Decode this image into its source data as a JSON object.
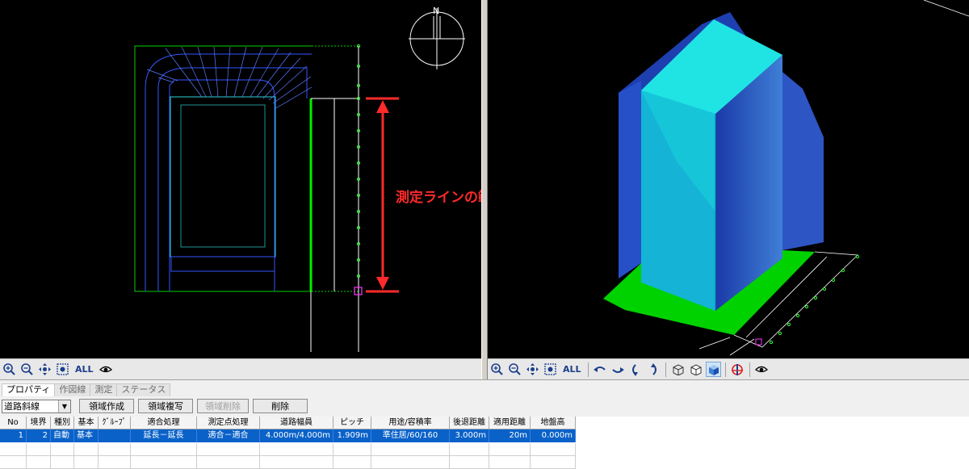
{
  "annotation": {
    "text": "測定ラインの範囲",
    "color": "#ff2a2a"
  },
  "compass": {
    "label": "N"
  },
  "toolbar_left": {
    "buttons": [
      "zoom-in-icon",
      "zoom-out-icon",
      "pan-icon",
      "fit-view-icon",
      "ALL",
      "view-eye-icon"
    ],
    "all_label": "ALL"
  },
  "toolbar_right": {
    "buttons": [
      "zoom-in-icon",
      "zoom-out-icon",
      "pan-icon",
      "fit-view-icon",
      "ALL",
      "rotate-left-icon",
      "rotate-right-icon",
      "rotate-down-icon",
      "rotate-up-icon",
      "wireframe-icon",
      "hidden-line-icon",
      "shaded-icon",
      "axis-icon",
      "view-eye-icon"
    ],
    "all_label": "ALL"
  },
  "panel": {
    "tabs": [
      "プロパティ",
      "作図線",
      "測定",
      "ステータス"
    ],
    "active_tab": 0,
    "select_value": "道路斜線",
    "buttons": {
      "create": "領域作成",
      "copy": "領域複写",
      "delete_region": "領域削除",
      "delete": "削除"
    }
  },
  "table": {
    "headers": [
      "No",
      "境界",
      "種別",
      "基本",
      "ｸﾞﾙｰﾌﾟ",
      "適合処理",
      "測定点処理",
      "道路幅員",
      "ピッチ",
      "用途/容積率",
      "後退距離",
      "適用距離",
      "地盤高"
    ],
    "rows": [
      [
        "1",
        "2",
        "自動",
        "基本",
        "",
        "延長－延長",
        "適合－適合",
        "4.000m/4.000m",
        "1.909m",
        "準住居/60/160",
        "3.000m",
        "20m",
        "0.000m"
      ]
    ]
  },
  "colors": {
    "viewport_bg": "#000000",
    "selection": "#0a62c9",
    "building_cyan": "#1fdcdc",
    "envelope_blue": "#2244cc",
    "ground_green": "#00d200"
  }
}
